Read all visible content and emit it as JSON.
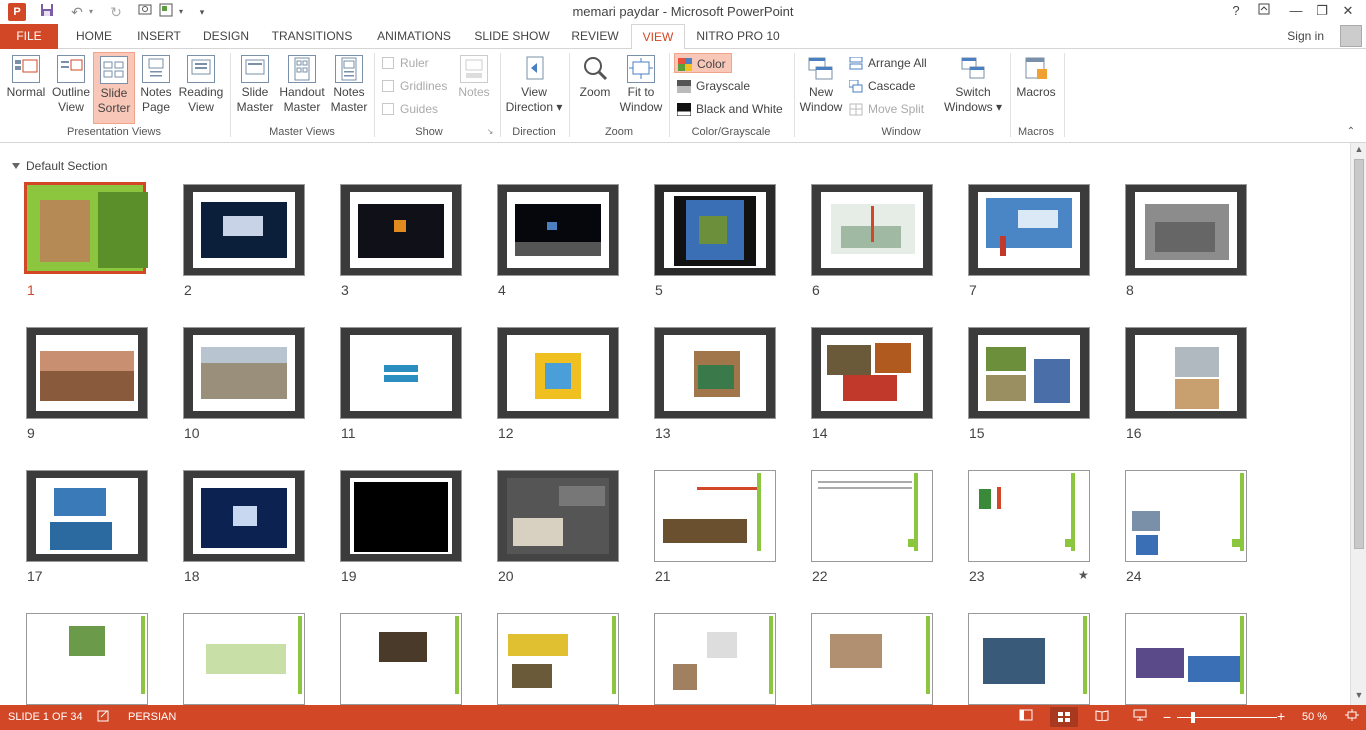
{
  "window": {
    "title": "memari paydar - Microsoft PowerPoint",
    "app_letter": "P",
    "help": "?",
    "ribbon_display": "⇧",
    "minimize": "—",
    "restore": "❐",
    "close": "✕"
  },
  "qat": {
    "save_icon": "save-icon",
    "undo_icon": "undo-icon",
    "redo_icon": "redo-icon",
    "customize": "▾"
  },
  "tabs": [
    "FILE",
    "HOME",
    "INSERT",
    "DESIGN",
    "TRANSITIONS",
    "ANIMATIONS",
    "SLIDE SHOW",
    "REVIEW",
    "VIEW",
    "NITRO PRO 10"
  ],
  "active_tab": "VIEW",
  "account": {
    "sign_in": "Sign in"
  },
  "ribbon": {
    "presentation_views": {
      "label": "Presentation Views",
      "normal": "Normal",
      "outline": [
        "Outline",
        "View"
      ],
      "sorter": [
        "Slide",
        "Sorter"
      ],
      "notes_page": [
        "Notes",
        "Page"
      ],
      "reading": [
        "Reading",
        "View"
      ]
    },
    "master_views": {
      "label": "Master Views",
      "slide": [
        "Slide",
        "Master"
      ],
      "handout": [
        "Handout",
        "Master"
      ],
      "notes": [
        "Notes",
        "Master"
      ]
    },
    "show": {
      "label": "Show",
      "ruler": "Ruler",
      "gridlines": "Gridlines",
      "guides": "Guides",
      "notes": "Notes"
    },
    "direction": {
      "label": "Direction",
      "btn": [
        "View",
        "Direction ▾"
      ]
    },
    "zoom": {
      "label": "Zoom",
      "zoom": "Zoom",
      "fit": [
        "Fit to",
        "Window"
      ]
    },
    "color": {
      "label": "Color/Grayscale",
      "color": "Color",
      "grayscale": "Grayscale",
      "bw": "Black and White"
    },
    "window": {
      "label": "Window",
      "new": [
        "New",
        "Window"
      ],
      "arrange": "Arrange All",
      "cascade": "Cascade",
      "move_split": "Move Split",
      "switch": [
        "Switch",
        "Windows ▾"
      ]
    },
    "macros": {
      "label": "Macros",
      "btn": "Macros"
    }
  },
  "sorter": {
    "section": "Default Section",
    "slides": [
      {
        "n": "1"
      },
      {
        "n": "2"
      },
      {
        "n": "3"
      },
      {
        "n": "4"
      },
      {
        "n": "5"
      },
      {
        "n": "6"
      },
      {
        "n": "7"
      },
      {
        "n": "8"
      },
      {
        "n": "9"
      },
      {
        "n": "10"
      },
      {
        "n": "11"
      },
      {
        "n": "12"
      },
      {
        "n": "13"
      },
      {
        "n": "14"
      },
      {
        "n": "15"
      },
      {
        "n": "16"
      },
      {
        "n": "17"
      },
      {
        "n": "18"
      },
      {
        "n": "19"
      },
      {
        "n": "20"
      },
      {
        "n": "21"
      },
      {
        "n": "22"
      },
      {
        "n": "23"
      },
      {
        "n": "24"
      }
    ],
    "slide23_mark": "★"
  },
  "status": {
    "slide_info": "SLIDE 1 OF 34",
    "language": "PERSIAN",
    "zoom_level": "50 %",
    "zoom_out": "−",
    "zoom_in": "+"
  },
  "colors": {
    "accent": "#d24726",
    "selected_bg": "#f9c7b7"
  }
}
